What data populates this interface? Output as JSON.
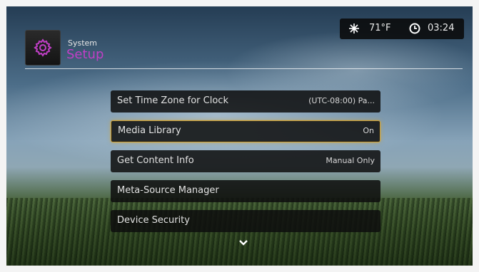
{
  "header": {
    "section": "System",
    "title": "Setup",
    "accent_color": "#c13fc7",
    "icon": "gear-icon"
  },
  "status": {
    "weather_icon": "sun-icon",
    "temperature": "71°F",
    "clock_icon": "clock-icon",
    "time": "03:24"
  },
  "menu": {
    "items": [
      {
        "label": "Set Time Zone for Clock",
        "value": "(UTC-08:00) Pa..."
      },
      {
        "label": "Media Library",
        "value": "On",
        "selected": true
      },
      {
        "label": "Get Content Info",
        "value": "Manual Only"
      },
      {
        "label": "Meta-Source Manager",
        "value": ""
      },
      {
        "label": "Device Security",
        "value": ""
      }
    ],
    "more_icon": "chevron-down-icon",
    "selection_color": "#d4a028"
  }
}
